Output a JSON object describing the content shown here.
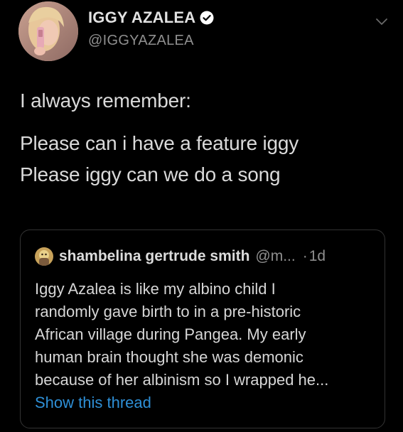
{
  "tweet": {
    "author": {
      "display_name": "IGGY AZALEA",
      "handle": "@IGGYAZALEA",
      "verified": true,
      "avatar_icon": "profile-photo-avatar"
    },
    "menu_icon": "chevron-down-icon",
    "text_lines": [
      "I always remember:",
      "Please can i have a feature iggy",
      "Please iggy can we do a song"
    ]
  },
  "quoted_tweet": {
    "author": {
      "display_name": "shambelina gertrude smith",
      "handle": "@m...",
      "separator": "·",
      "time": "1d",
      "avatar_icon": "profile-photo-avatar"
    },
    "text_lines": [
      "Iggy Azalea is like my albino child I",
      "randomly gave birth to in a pre-historic",
      "African village during Pangea. My early",
      "human brain thought she was demonic",
      "because of her albinism so I wrapped he..."
    ],
    "show_thread_label": "Show this thread"
  },
  "colors": {
    "background": "#000000",
    "primary_text": "#dadada",
    "secondary_text": "#8f8f8f",
    "link": "#2e8fd6",
    "card_border": "#333333",
    "verified_badge": "#ffffff"
  }
}
